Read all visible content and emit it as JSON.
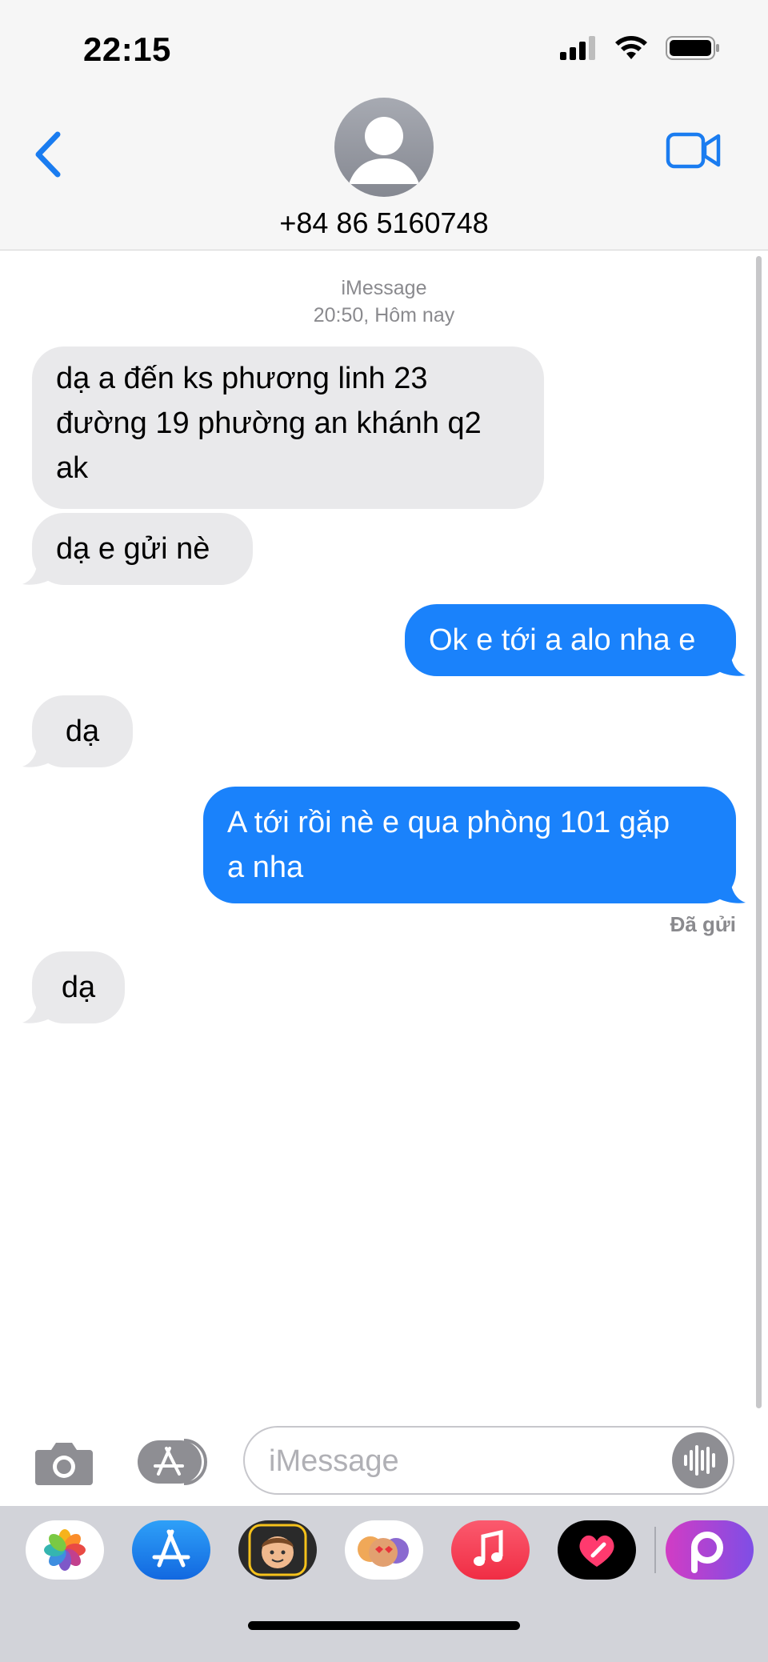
{
  "status_bar": {
    "time": "22:15"
  },
  "header": {
    "contact": "+84 86 5160748"
  },
  "conversation": {
    "service": "iMessage",
    "timestamp": "20:50, Hôm nay",
    "messages": [
      {
        "direction": "incoming",
        "lines": [
          "dạ a đến ks phương linh 23",
          "đường 19 phường an khánh q2",
          "ak"
        ]
      },
      {
        "direction": "incoming",
        "lines": [
          "dạ e gửi nè"
        ]
      },
      {
        "direction": "outgoing",
        "lines": [
          "Ok e tới a alo nha e"
        ]
      },
      {
        "direction": "incoming",
        "lines": [
          "dạ"
        ]
      },
      {
        "direction": "outgoing",
        "lines": [
          "A tới rồi nè e qua phòng 101 gặp",
          "a nha"
        ]
      },
      {
        "direction": "incoming",
        "lines": [
          "dạ"
        ]
      }
    ],
    "delivery_status": "Đã gửi"
  },
  "composer": {
    "placeholder": "iMessage"
  },
  "app_drawer": [
    "photos-app",
    "app-store-app",
    "memoji-app",
    "animoji-stickers-app",
    "music-app",
    "fitness-heart-app",
    "picsart-app"
  ],
  "colors": {
    "outgoing_bubble": "#1a82fb",
    "incoming_bubble": "#e9e9eb",
    "accent": "#1a7cf0"
  }
}
